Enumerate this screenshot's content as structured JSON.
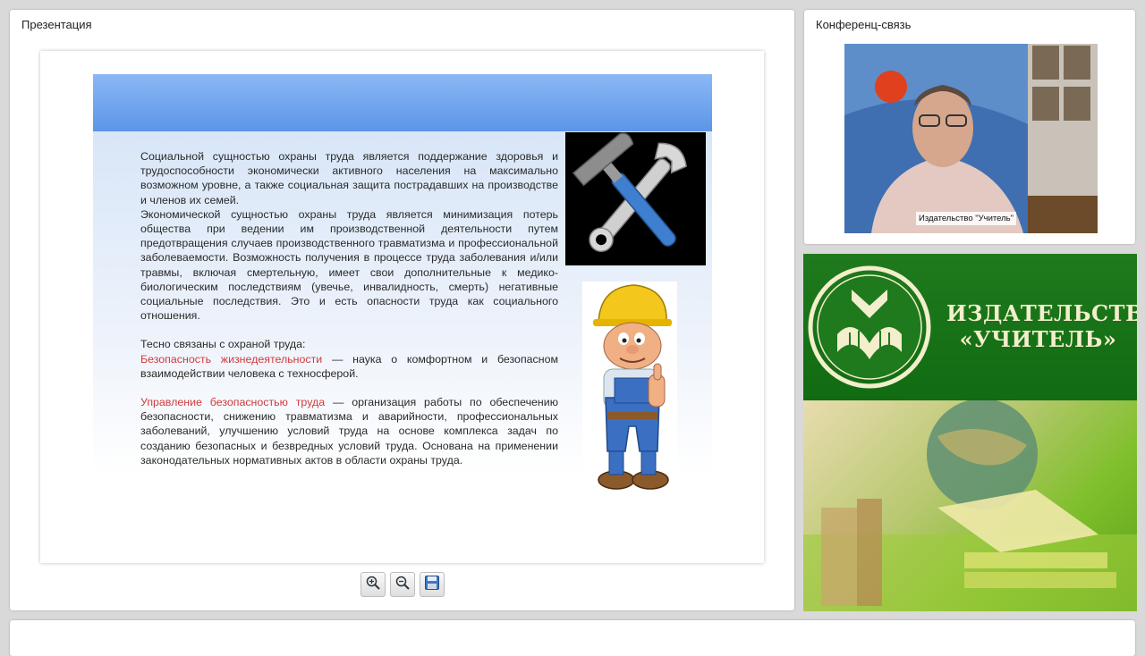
{
  "presentation": {
    "title": "Презентация",
    "slide": {
      "paragraphs": [
        "Социальной сущностью охраны труда является поддержание здоровья и трудоспособности экономически активного населения на максимально возможном уровне, а также социальная защита пострадавших на производстве и членов их семей.",
        "Экономической сущностью охраны труда является минимизация потерь общества при ведении им производственной деятельности путем предотвращения случаев производственного травматизма и профессиональной заболеваемости. Возможность получения в процессе труда заболевания и/или травмы, включая смертельную, имеет свои дополнительные к медико-биологическим последствиям (увечье, инвалидность, смерть) негативные социальные последствия. Это и есть опасности труда как социального отношения.",
        "Тесно связаны с охраной труда:"
      ],
      "terms": [
        {
          "term": "Безопасность жизнедеятельности",
          "definition": " — наука о комфортном и безопасном взаимодействии человека с техносферой."
        },
        {
          "term": "Управление безопасностью труда",
          "definition": " — организация работы по обеспечению безопасности, снижению травматизма и аварийности, профессиональных заболеваний, улучшению условий труда на основе комплекса задач по созданию безопасных и безвредных условий труда. Основана на применении законодательных нормативных актов в области охраны труда."
        }
      ],
      "colors": {
        "header_bar": "#6fa4ee",
        "term": "#d23a3a"
      }
    },
    "toolbar": {
      "zoom_in_icon": "zoom-in-icon",
      "zoom_out_icon": "zoom-out-icon",
      "save_icon": "floppy-disk-icon"
    }
  },
  "conference": {
    "title": "Конференц-связь",
    "video_caption": "Издательство \"Учитель\""
  },
  "publisher": {
    "name_line1": "ИЗДАТЕЛЬСТВО",
    "name_line2": "«УЧИТЕЛЬ»",
    "colors": {
      "banner_green": "#1a741a",
      "text": "#f3eecb"
    }
  }
}
